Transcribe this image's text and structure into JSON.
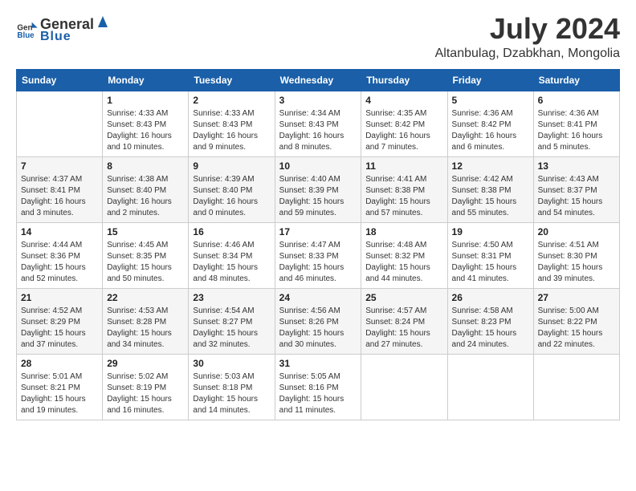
{
  "header": {
    "logo_general": "General",
    "logo_blue": "Blue",
    "month_title": "July 2024",
    "location": "Altanbulag, Dzabkhan, Mongolia"
  },
  "weekdays": [
    "Sunday",
    "Monday",
    "Tuesday",
    "Wednesday",
    "Thursday",
    "Friday",
    "Saturday"
  ],
  "weeks": [
    [
      {
        "day": "",
        "sunrise": "",
        "sunset": "",
        "daylight": ""
      },
      {
        "day": "1",
        "sunrise": "Sunrise: 4:33 AM",
        "sunset": "Sunset: 8:43 PM",
        "daylight": "Daylight: 16 hours and 10 minutes."
      },
      {
        "day": "2",
        "sunrise": "Sunrise: 4:33 AM",
        "sunset": "Sunset: 8:43 PM",
        "daylight": "Daylight: 16 hours and 9 minutes."
      },
      {
        "day": "3",
        "sunrise": "Sunrise: 4:34 AM",
        "sunset": "Sunset: 8:43 PM",
        "daylight": "Daylight: 16 hours and 8 minutes."
      },
      {
        "day": "4",
        "sunrise": "Sunrise: 4:35 AM",
        "sunset": "Sunset: 8:42 PM",
        "daylight": "Daylight: 16 hours and 7 minutes."
      },
      {
        "day": "5",
        "sunrise": "Sunrise: 4:36 AM",
        "sunset": "Sunset: 8:42 PM",
        "daylight": "Daylight: 16 hours and 6 minutes."
      },
      {
        "day": "6",
        "sunrise": "Sunrise: 4:36 AM",
        "sunset": "Sunset: 8:41 PM",
        "daylight": "Daylight: 16 hours and 5 minutes."
      }
    ],
    [
      {
        "day": "7",
        "sunrise": "Sunrise: 4:37 AM",
        "sunset": "Sunset: 8:41 PM",
        "daylight": "Daylight: 16 hours and 3 minutes."
      },
      {
        "day": "8",
        "sunrise": "Sunrise: 4:38 AM",
        "sunset": "Sunset: 8:40 PM",
        "daylight": "Daylight: 16 hours and 2 minutes."
      },
      {
        "day": "9",
        "sunrise": "Sunrise: 4:39 AM",
        "sunset": "Sunset: 8:40 PM",
        "daylight": "Daylight: 16 hours and 0 minutes."
      },
      {
        "day": "10",
        "sunrise": "Sunrise: 4:40 AM",
        "sunset": "Sunset: 8:39 PM",
        "daylight": "Daylight: 15 hours and 59 minutes."
      },
      {
        "day": "11",
        "sunrise": "Sunrise: 4:41 AM",
        "sunset": "Sunset: 8:38 PM",
        "daylight": "Daylight: 15 hours and 57 minutes."
      },
      {
        "day": "12",
        "sunrise": "Sunrise: 4:42 AM",
        "sunset": "Sunset: 8:38 PM",
        "daylight": "Daylight: 15 hours and 55 minutes."
      },
      {
        "day": "13",
        "sunrise": "Sunrise: 4:43 AM",
        "sunset": "Sunset: 8:37 PM",
        "daylight": "Daylight: 15 hours and 54 minutes."
      }
    ],
    [
      {
        "day": "14",
        "sunrise": "Sunrise: 4:44 AM",
        "sunset": "Sunset: 8:36 PM",
        "daylight": "Daylight: 15 hours and 52 minutes."
      },
      {
        "day": "15",
        "sunrise": "Sunrise: 4:45 AM",
        "sunset": "Sunset: 8:35 PM",
        "daylight": "Daylight: 15 hours and 50 minutes."
      },
      {
        "day": "16",
        "sunrise": "Sunrise: 4:46 AM",
        "sunset": "Sunset: 8:34 PM",
        "daylight": "Daylight: 15 hours and 48 minutes."
      },
      {
        "day": "17",
        "sunrise": "Sunrise: 4:47 AM",
        "sunset": "Sunset: 8:33 PM",
        "daylight": "Daylight: 15 hours and 46 minutes."
      },
      {
        "day": "18",
        "sunrise": "Sunrise: 4:48 AM",
        "sunset": "Sunset: 8:32 PM",
        "daylight": "Daylight: 15 hours and 44 minutes."
      },
      {
        "day": "19",
        "sunrise": "Sunrise: 4:50 AM",
        "sunset": "Sunset: 8:31 PM",
        "daylight": "Daylight: 15 hours and 41 minutes."
      },
      {
        "day": "20",
        "sunrise": "Sunrise: 4:51 AM",
        "sunset": "Sunset: 8:30 PM",
        "daylight": "Daylight: 15 hours and 39 minutes."
      }
    ],
    [
      {
        "day": "21",
        "sunrise": "Sunrise: 4:52 AM",
        "sunset": "Sunset: 8:29 PM",
        "daylight": "Daylight: 15 hours and 37 minutes."
      },
      {
        "day": "22",
        "sunrise": "Sunrise: 4:53 AM",
        "sunset": "Sunset: 8:28 PM",
        "daylight": "Daylight: 15 hours and 34 minutes."
      },
      {
        "day": "23",
        "sunrise": "Sunrise: 4:54 AM",
        "sunset": "Sunset: 8:27 PM",
        "daylight": "Daylight: 15 hours and 32 minutes."
      },
      {
        "day": "24",
        "sunrise": "Sunrise: 4:56 AM",
        "sunset": "Sunset: 8:26 PM",
        "daylight": "Daylight: 15 hours and 30 minutes."
      },
      {
        "day": "25",
        "sunrise": "Sunrise: 4:57 AM",
        "sunset": "Sunset: 8:24 PM",
        "daylight": "Daylight: 15 hours and 27 minutes."
      },
      {
        "day": "26",
        "sunrise": "Sunrise: 4:58 AM",
        "sunset": "Sunset: 8:23 PM",
        "daylight": "Daylight: 15 hours and 24 minutes."
      },
      {
        "day": "27",
        "sunrise": "Sunrise: 5:00 AM",
        "sunset": "Sunset: 8:22 PM",
        "daylight": "Daylight: 15 hours and 22 minutes."
      }
    ],
    [
      {
        "day": "28",
        "sunrise": "Sunrise: 5:01 AM",
        "sunset": "Sunset: 8:21 PM",
        "daylight": "Daylight: 15 hours and 19 minutes."
      },
      {
        "day": "29",
        "sunrise": "Sunrise: 5:02 AM",
        "sunset": "Sunset: 8:19 PM",
        "daylight": "Daylight: 15 hours and 16 minutes."
      },
      {
        "day": "30",
        "sunrise": "Sunrise: 5:03 AM",
        "sunset": "Sunset: 8:18 PM",
        "daylight": "Daylight: 15 hours and 14 minutes."
      },
      {
        "day": "31",
        "sunrise": "Sunrise: 5:05 AM",
        "sunset": "Sunset: 8:16 PM",
        "daylight": "Daylight: 15 hours and 11 minutes."
      },
      {
        "day": "",
        "sunrise": "",
        "sunset": "",
        "daylight": ""
      },
      {
        "day": "",
        "sunrise": "",
        "sunset": "",
        "daylight": ""
      },
      {
        "day": "",
        "sunrise": "",
        "sunset": "",
        "daylight": ""
      }
    ]
  ]
}
